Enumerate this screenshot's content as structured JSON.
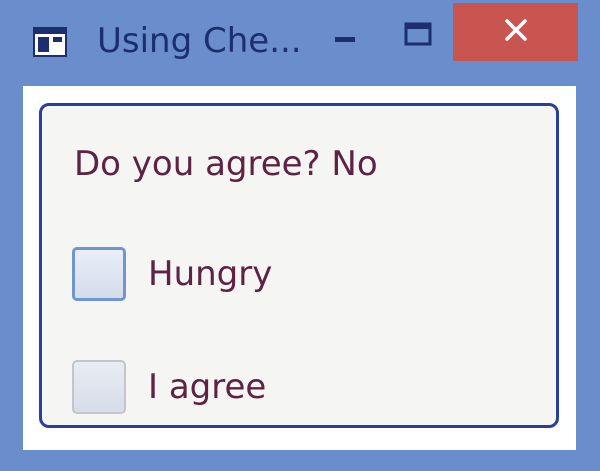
{
  "window": {
    "title": "Using Che...",
    "icons": {
      "app": "window-app-icon",
      "minimize": "minimize-icon",
      "maximize": "maximize-icon",
      "close": "close-icon"
    },
    "colors": {
      "frame": "#6a8ecb",
      "close": "#c8554f",
      "group_border": "#2a3f9c",
      "text": "#5e2342"
    }
  },
  "main": {
    "status_text": "Do you agree? No",
    "checkboxes": [
      {
        "label": "Hungry",
        "checked": false,
        "focused": true
      },
      {
        "label": "I agree",
        "checked": false,
        "focused": false
      }
    ]
  }
}
